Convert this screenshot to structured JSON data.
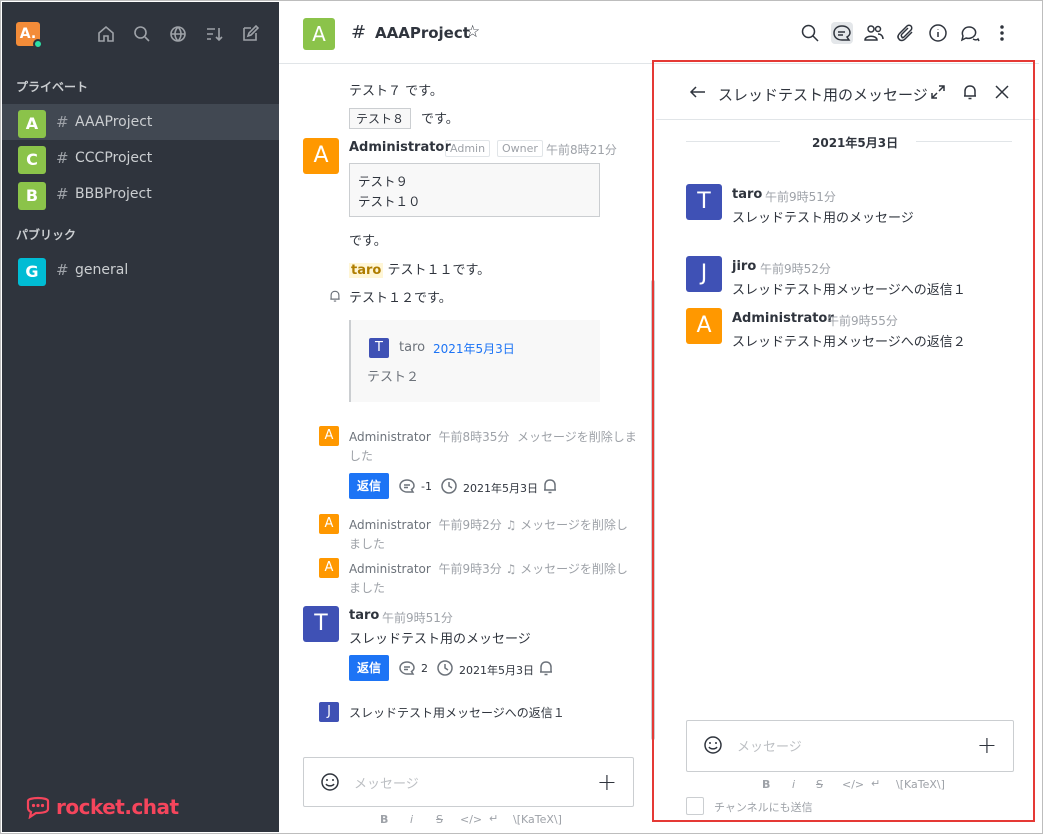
{
  "sidebar": {
    "user_initial": "A.",
    "section_private": "プライベート",
    "section_public": "パブリック",
    "rooms": [
      {
        "initial": "A",
        "name": "AAAProject",
        "color": "#8bc34a"
      },
      {
        "initial": "C",
        "name": "CCCProject",
        "color": "#8bc34a"
      },
      {
        "initial": "B",
        "name": "BBBProject",
        "color": "#8bc34a"
      }
    ],
    "public_rooms": [
      {
        "initial": "G",
        "name": "general",
        "color": "#00bcd4"
      }
    ],
    "logo_text": "rocket.chat",
    "room_hash": "#"
  },
  "header": {
    "avatar": "A",
    "hash": "#",
    "title": "AAAProject",
    "star": "☆"
  },
  "messages": {
    "line_top": "テスト７ です。",
    "code8": "テスト８",
    "code8_after": "です。",
    "admin_name": "Administrator",
    "admin_tag": "Admin",
    "owner_tag": "Owner",
    "admin_time": "午前8時21分",
    "code_block_1": "テスト９",
    "code_block_2": "テスト１０",
    "desu": "です。",
    "mention": "taro",
    "mention_after": "テスト１１です。",
    "test12": "テスト１２です。",
    "quote_avatar": "T",
    "quote_name": "taro",
    "quote_date": "2021年5月3日",
    "quote_text": "テスト２",
    "sys1_name": "Administrator",
    "sys1_time": "午前8時35分",
    "sys1_text": "メッセージを削除しま",
    "sys1_text2": "した",
    "reply_label": "返信",
    "reply1_count": "-1",
    "reply1_date": "2021年5月3日",
    "sys2_name": "Administrator",
    "sys2_time": "午前9時2分",
    "sys2_text": "メッセージを削除し",
    "sys2_text2": "ました",
    "sys3_name": "Administrator",
    "sys3_time": "午前9時3分",
    "sys3_text": "メッセージを削除し",
    "sys3_text2": "ました",
    "taro_avatar": "T",
    "taro_name": "taro",
    "taro_time": "午前9時51分",
    "taro_text": "スレッドテスト用のメッセージ",
    "reply2_count": "2",
    "reply2_date": "2021年5月3日",
    "jiro_avatar": "J",
    "jiro_reply": "スレッドテスト用メッセージへの返信１"
  },
  "composer": {
    "placeholder": "メッセージ",
    "format_bold": "B",
    "format_italic": "i",
    "format_strike": "S",
    "format_code": "</>",
    "format_katex": "\\[KaTeX\\]"
  },
  "thread": {
    "title": "スレッドテスト用のメッセージ",
    "date": "2021年5月3日",
    "items": [
      {
        "avatar": "T",
        "name": "taro",
        "time": "午前9時51分",
        "text": "スレッドテスト用のメッセージ",
        "color": "#3f51b5"
      },
      {
        "avatar": "J",
        "name": "jiro",
        "time": "午前9時52分",
        "text": "スレッドテスト用メッセージへの返信１",
        "color": "#3f51b5"
      },
      {
        "avatar": "A",
        "name": "Administrator",
        "time": "午前9時55分",
        "text": "スレッドテスト用メッセージへの返信２",
        "color": "#ff9800"
      }
    ],
    "placeholder": "メッセージ",
    "also_send": "チャンネルにも送信"
  },
  "colors": {
    "sidebar_bg": "#2f343d",
    "accent_blue": "#1d74f5",
    "admin_orange": "#ff9800",
    "user_indigo": "#3f51b5",
    "highlight_red": "#e53935",
    "brand_red": "#f5455c"
  }
}
